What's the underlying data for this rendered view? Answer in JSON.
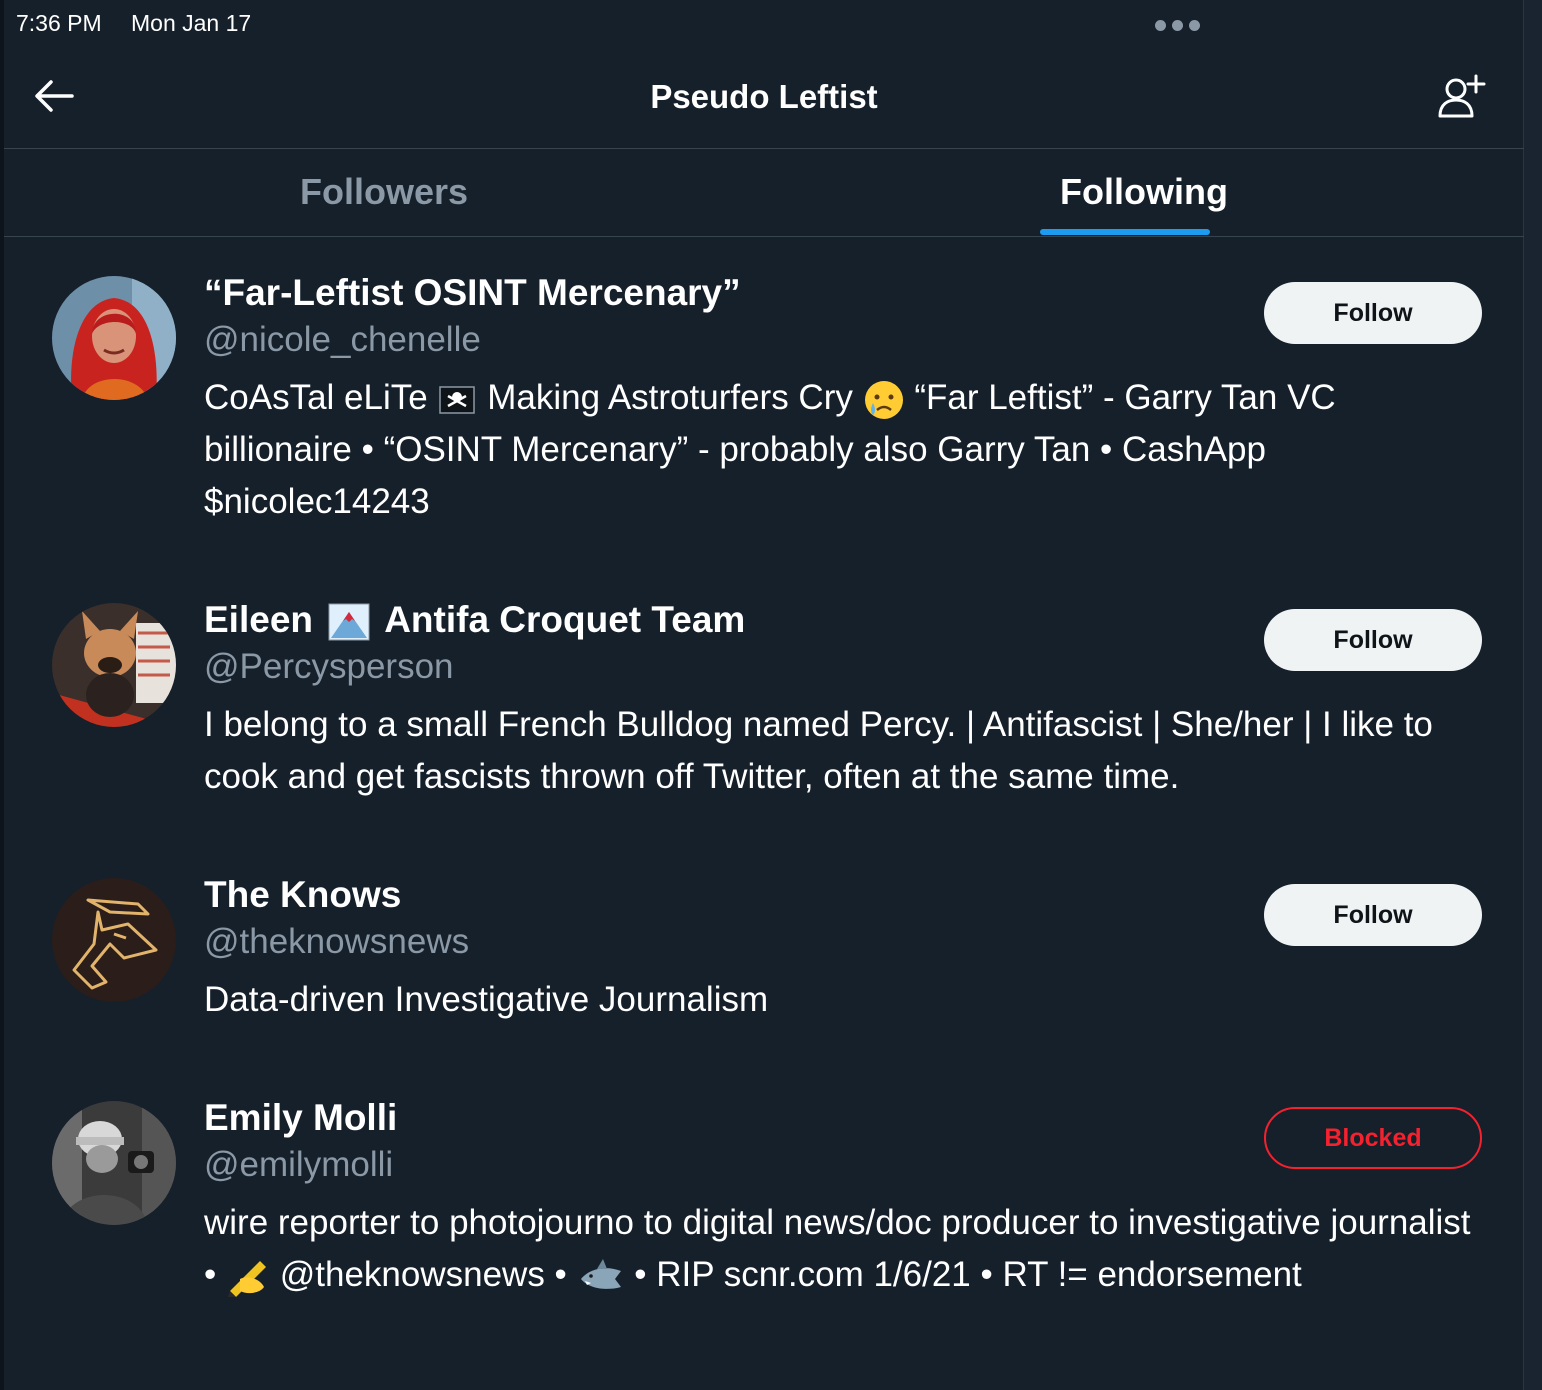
{
  "status_bar": {
    "time": "7:36 PM",
    "date": "Mon Jan 17"
  },
  "header": {
    "title": "Pseudo Leftist",
    "back_icon": "arrow-left-icon",
    "add_user_icon": "add-user-icon"
  },
  "tabs": [
    {
      "label": "Followers",
      "active": false
    },
    {
      "label": "Following",
      "active": true
    }
  ],
  "colors": {
    "background": "#15202b",
    "accent": "#1d9bf0",
    "secondary_text": "#8b98a5",
    "blocked": "#f4212e",
    "follow_button_bg": "#eff3f4"
  },
  "users": [
    {
      "display_name": "“Far-Leftist OSINT Mercenary”",
      "handle": "@nicole_chenelle",
      "bio_parts": [
        "CoAsTal eLiTe",
        "Making Astroturfers Cry",
        "“Far Leftist” - Garry Tan VC billionaire • “OSINT Mercenary” - probably also Garry Tan • CashApp $nicolec14243"
      ],
      "bio_emojis": [
        "pirate-flag-icon",
        "crying-face-icon"
      ],
      "action": "Follow",
      "avatar": "red-haired-woman-avatar"
    },
    {
      "display_name_parts": [
        "Eileen",
        "Antifa Croquet Team"
      ],
      "name_emoji": "mount-fuji-icon",
      "handle": "@Percysperson",
      "bio": "I belong to a small French Bulldog named Percy. | Antifascist | She/her | I like to cook and get fascists thrown off Twitter, often at the same time.",
      "action": "Follow",
      "avatar": "french-bulldog-avatar"
    },
    {
      "display_name": "The Knows",
      "handle": "@theknowsnews",
      "bio": "Data-driven Investigative Journalism",
      "action": "Follow",
      "avatar": "the-knows-logo-avatar"
    },
    {
      "display_name": "Emily Molli",
      "handle": "@emilymolli",
      "bio_parts": [
        "wire reporter to photojourno to digital news/doc producer to investigative journalist •",
        "@theknowsnews •",
        "• RIP scnr.com 1/6/21 • RT != endorsement"
      ],
      "bio_emojis": [
        "writing-hand-icon",
        "shark-icon"
      ],
      "action": "Blocked",
      "avatar": "helmet-photographer-avatar"
    }
  ]
}
